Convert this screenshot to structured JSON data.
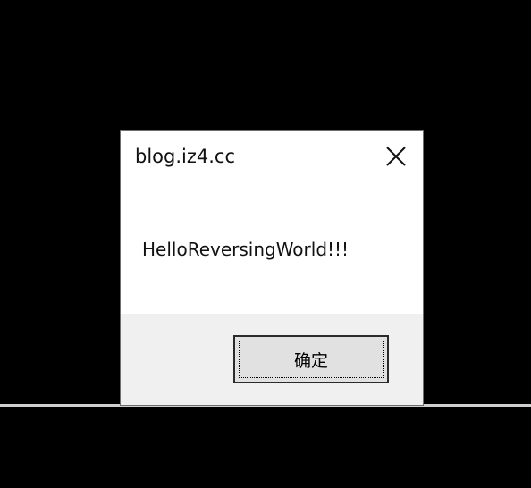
{
  "dialog": {
    "title": "blog.iz4.cc",
    "message": "HelloReversingWorld!!!",
    "ok_label": "确定",
    "close_icon": "close-icon"
  },
  "colors": {
    "desktop": "#000000",
    "dialog_bg": "#ffffff",
    "footer_bg": "#f0f0f0",
    "button_bg": "#e1e1e1",
    "button_border": "#2b2b2b"
  }
}
